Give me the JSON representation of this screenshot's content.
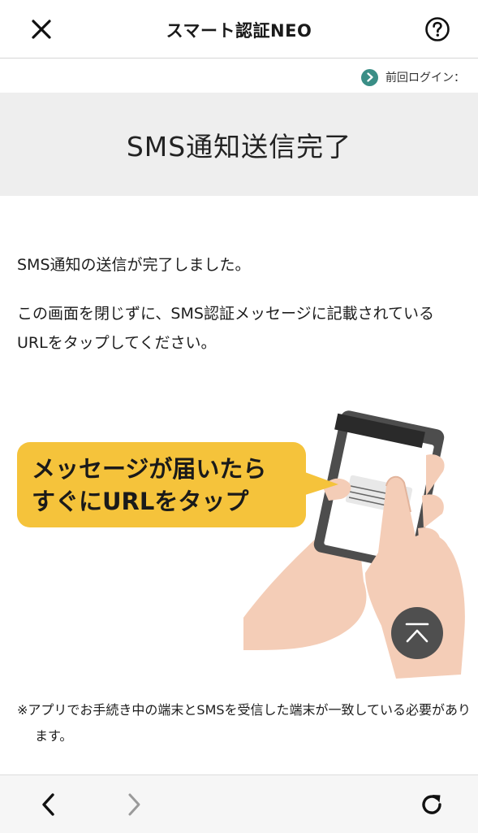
{
  "header": {
    "title": "スマート認証NEO",
    "close_icon": "close-icon",
    "help_icon": "help-icon"
  },
  "last_login": {
    "label": "前回ログイン："
  },
  "banner": {
    "title": "SMS通知送信完了"
  },
  "body": {
    "message1": "SMS通知の送信が完了しました。",
    "message2": "この画面を閉じずに、SMS認証メッセージに記載されているURLをタップしてください。"
  },
  "illustration": {
    "callout_text": "メッセージが届いたら\nすぐにURLをタップ"
  },
  "note": {
    "text": "※アプリでお手続き中の端末とSMSを受信した端末が一致している必要があります。"
  },
  "toolbar": {
    "back_icon": "chevron-left-icon",
    "forward_icon": "chevron-right-icon",
    "reload_icon": "reload-icon"
  },
  "colors": {
    "accent_green": "#3a8e86",
    "callout_yellow": "#f5c33b",
    "banner_bg": "#eeeeee",
    "skin": "#f4cdb7"
  }
}
